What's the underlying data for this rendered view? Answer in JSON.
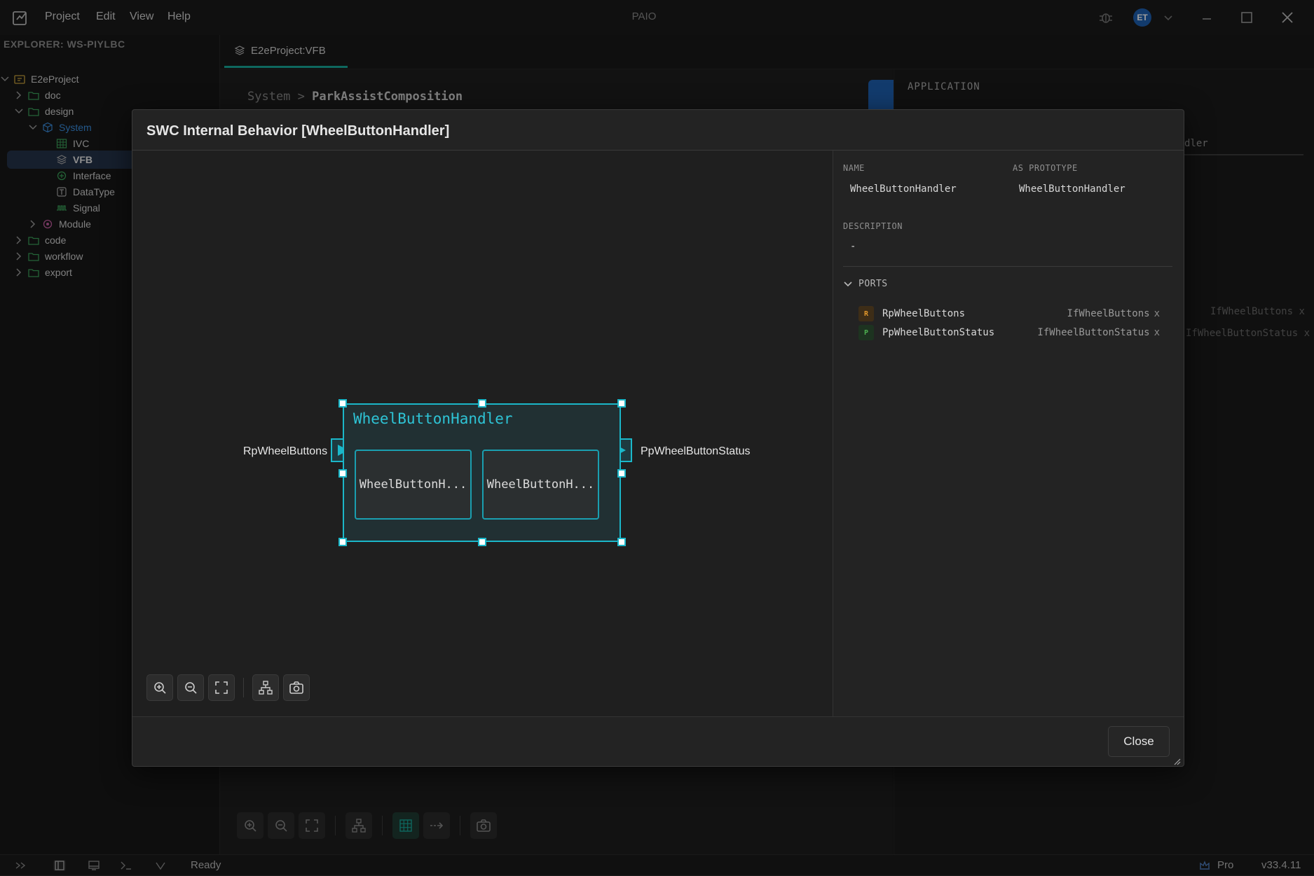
{
  "app": {
    "title": "PAIO",
    "menu": [
      "Project",
      "Edit",
      "View",
      "Help"
    ],
    "avatar_initials": "ET"
  },
  "sidebar": {
    "header": "EXPLORER: WS-PIYLBC",
    "tree": [
      {
        "label": "E2eProject",
        "icon": "project-folder-icon",
        "chevron": "down"
      },
      {
        "label": "doc",
        "icon": "folder-icon",
        "chevron": "right"
      },
      {
        "label": "design",
        "icon": "folder-icon",
        "chevron": "down"
      },
      {
        "label": "System",
        "icon": "cube-icon",
        "chevron": "down"
      },
      {
        "label": "IVC",
        "icon": "grid-icon",
        "chevron": ""
      },
      {
        "label": "VFB",
        "icon": "layers-icon",
        "chevron": "",
        "active": true
      },
      {
        "label": "Interface",
        "icon": "interface-icon",
        "chevron": ""
      },
      {
        "label": "DataType",
        "icon": "type-icon",
        "chevron": ""
      },
      {
        "label": "Signal",
        "icon": "signal-icon",
        "chevron": ""
      },
      {
        "label": "Module",
        "icon": "module-icon",
        "chevron": "right"
      },
      {
        "label": "code",
        "icon": "folder-icon",
        "chevron": "right"
      },
      {
        "label": "workflow",
        "icon": "folder-icon",
        "chevron": "right"
      },
      {
        "label": "export",
        "icon": "folder-icon",
        "chevron": "right"
      }
    ]
  },
  "editor": {
    "tab_label": "E2eProject:VFB",
    "breadcrumb_root": "System",
    "breadcrumb_sep": ">",
    "breadcrumb_current": "ParkAssistComposition",
    "right_panel_title": "APPLICATION",
    "ghost_text": {
      "name_fragment": "dler",
      "port_if_1": "IfWheelButtons",
      "port_if_2": "IfWheelButtonStatus",
      "x": "x"
    }
  },
  "modal": {
    "title": "SWC Internal Behavior [WheelButtonHandler]",
    "diagram": {
      "component_name": "WheelButtonHandler",
      "runnables": [
        "WheelButtonH...",
        "WheelButtonH..."
      ],
      "in_port_label": "RpWheelButtons",
      "out_port_label": "PpWheelButtonStatus"
    },
    "props": {
      "name_label": "NAME",
      "name_value": "WheelButtonHandler",
      "prototype_label": "AS PROTOTYPE",
      "prototype_value": "WheelButtonHandler",
      "description_label": "DESCRIPTION",
      "description_value": "-",
      "ports_label": "PORTS",
      "ports": [
        {
          "badge": "R",
          "name": "RpWheelButtons",
          "interface": "IfWheelButtons",
          "remove": "x",
          "badge_color": "#e0962a",
          "badge_bg": "#3d2d17"
        },
        {
          "badge": "P",
          "name": "PpWheelButtonStatus",
          "interface": "IfWheelButtonStatus",
          "remove": "x",
          "badge_color": "#4caf50",
          "badge_bg": "#1d3320"
        }
      ]
    },
    "close_label": "Close"
  },
  "status": {
    "ready": "Ready",
    "plan": "Pro",
    "version": "v33.4.11"
  },
  "colors": {
    "accent": "#1bb7c9",
    "tab_underline": "#17a89a",
    "avatar": "#1e5fb0"
  }
}
